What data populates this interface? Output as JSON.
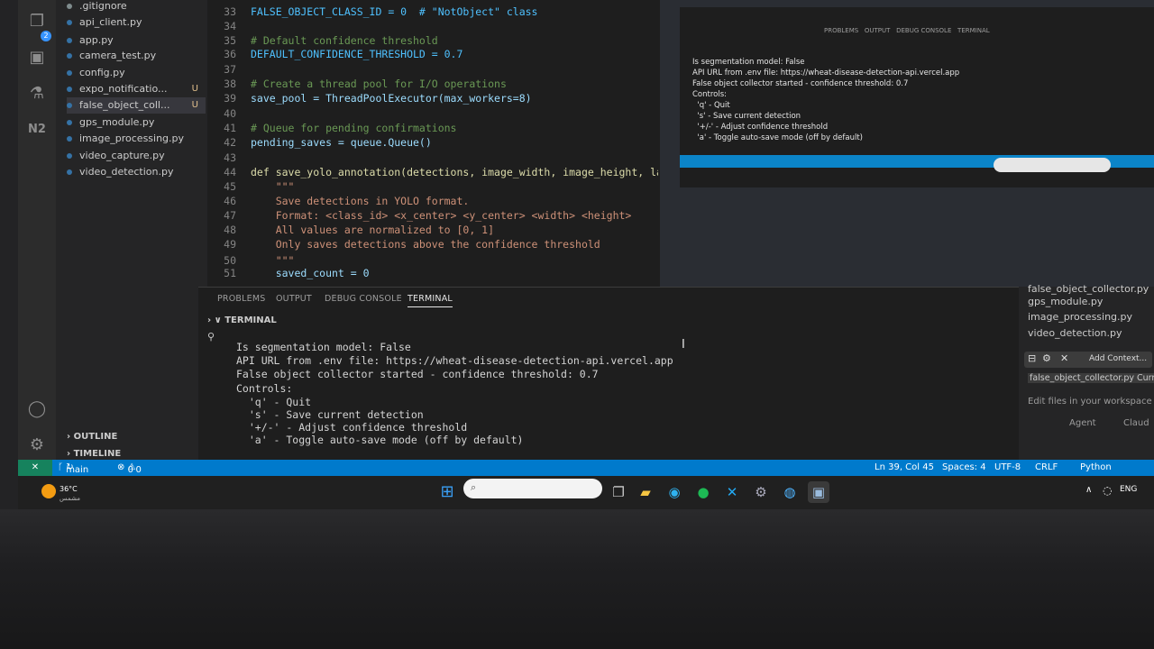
{
  "sidebar": {
    "files": [
      {
        "name": ".gitignore",
        "status": "",
        "color": "#7f8c8d"
      },
      {
        "name": "api_client.py",
        "status": "",
        "color": "#3572A5"
      },
      {
        "name": "app.py",
        "status": "",
        "color": "#3572A5"
      },
      {
        "name": "camera_test.py",
        "status": "",
        "color": "#3572A5"
      },
      {
        "name": "config.py",
        "status": "",
        "color": "#3572A5"
      },
      {
        "name": "expo_notificatio...",
        "status": "U",
        "color": "#3572A5"
      },
      {
        "name": "false_object_coll...",
        "status": "U",
        "color": "#3572A5"
      },
      {
        "name": "gps_module.py",
        "status": "",
        "color": "#3572A5"
      },
      {
        "name": "image_processing.py",
        "status": "",
        "color": "#3572A5"
      },
      {
        "name": "video_capture.py",
        "status": "",
        "color": "#3572A5"
      },
      {
        "name": "video_detection.py",
        "status": "",
        "color": "#3572A5"
      }
    ],
    "outline_label": "OUTLINE",
    "timeline_label": "TIMELINE",
    "activity_badge": "2"
  },
  "editor": {
    "lines": [
      {
        "n": "33",
        "text": "FALSE_OBJECT_CLASS_ID = 0  # \"NotObject\" class"
      },
      {
        "n": "34",
        "text": ""
      },
      {
        "n": "35",
        "text": "# Default confidence threshold"
      },
      {
        "n": "36",
        "text": "DEFAULT_CONFIDENCE_THRESHOLD = 0.7"
      },
      {
        "n": "37",
        "text": ""
      },
      {
        "n": "38",
        "text": "# Create a thread pool for I/O operations"
      },
      {
        "n": "39",
        "text": "save_pool = ThreadPoolExecutor(max_workers=8)"
      },
      {
        "n": "40",
        "text": ""
      },
      {
        "n": "41",
        "text": "# Queue for pending confirmations"
      },
      {
        "n": "42",
        "text": "pending_saves = queue.Queue()"
      },
      {
        "n": "43",
        "text": ""
      },
      {
        "n": "44",
        "text": "def save_yolo_annotation(detections, image_width, image_height, label"
      },
      {
        "n": "45",
        "text": "    \"\"\""
      },
      {
        "n": "46",
        "text": "    Save detections in YOLO format."
      },
      {
        "n": "47",
        "text": "    Format: <class_id> <x_center> <y_center> <width> <height>"
      },
      {
        "n": "48",
        "text": "    All values are normalized to [0, 1]"
      },
      {
        "n": "49",
        "text": "    Only saves detections above the confidence threshold"
      },
      {
        "n": "50",
        "text": "    \"\"\""
      },
      {
        "n": "51",
        "text": "    saved_count = 0"
      }
    ]
  },
  "panel": {
    "tabs": [
      "PROBLEMS",
      "OUTPUT",
      "DEBUG CONSOLE",
      "TERMINAL"
    ],
    "active_tab": "TERMINAL",
    "section_title": "TERMINAL",
    "terminal_lines": [
      "Is segmentation model: False",
      "API URL from .env file: https://wheat-disease-detection-api.vercel.app",
      "False object collector started - confidence threshold: 0.7",
      "Controls:",
      "  'q' - Quit",
      "  's' - Save current detection",
      "  '+/-' - Adjust confidence threshold",
      "  'a' - Toggle auto-save mode (off by default)"
    ]
  },
  "chat": {
    "files": [
      "false_object_collector.py",
      "gps_module.py",
      "image_processing.py",
      "video_detection.py"
    ],
    "add_context": "Add Context...",
    "current_file": "false_object_collector.py Current",
    "hint": "Edit files in your workspace in a",
    "agent": "Agent",
    "model": "Claud"
  },
  "status": {
    "branch": "main",
    "errors": "0",
    "warnings": "0",
    "position": "Ln 39, Col 45",
    "spaces": "Spaces: 4",
    "encoding": "UTF-8",
    "eol": "CRLF",
    "language": "Python"
  },
  "taskbar": {
    "weather_temp": "36°C",
    "weather_desc": "مشمس",
    "search_placeholder": "",
    "lang": "ENG"
  },
  "colors": {
    "statusbar": "#007acc",
    "editor_bg": "#1e1e1e",
    "sidebar_bg": "#252526"
  }
}
